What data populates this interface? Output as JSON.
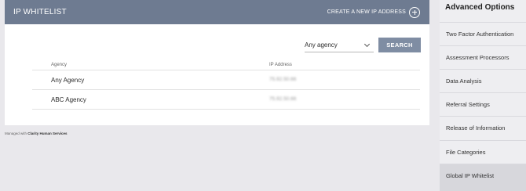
{
  "header": {
    "title": "IP WHITELIST",
    "create_label": "CREATE A NEW IP ADDRESS",
    "create_icon": "plus-circle-icon"
  },
  "filter": {
    "selected": "Any agency",
    "search_label": "SEARCH"
  },
  "table": {
    "columns": [
      "Agency",
      "IP Address"
    ],
    "rows": [
      {
        "agency": "Any Agency",
        "ip": "75.92.50.66"
      },
      {
        "agency": "ABC Agency",
        "ip": "75.92.50.66"
      }
    ]
  },
  "footer": {
    "prefix": "Managed with ",
    "brand": "Clarity Human Services"
  },
  "sidebar": {
    "title": "Advanced Options",
    "items": [
      {
        "label": "Two Factor Authentication"
      },
      {
        "label": "Assessment Processors"
      },
      {
        "label": "Data Analysis"
      },
      {
        "label": "Referral Settings"
      },
      {
        "label": "Release of Information"
      },
      {
        "label": "File Categories"
      },
      {
        "label": "Global IP Whitelist",
        "active": true
      }
    ]
  },
  "colors": {
    "header_bg": "#6e7b91",
    "button_bg": "#7f8da3",
    "page_bg": "#e9e8ec",
    "active_item_bg": "#d7d7dc"
  }
}
